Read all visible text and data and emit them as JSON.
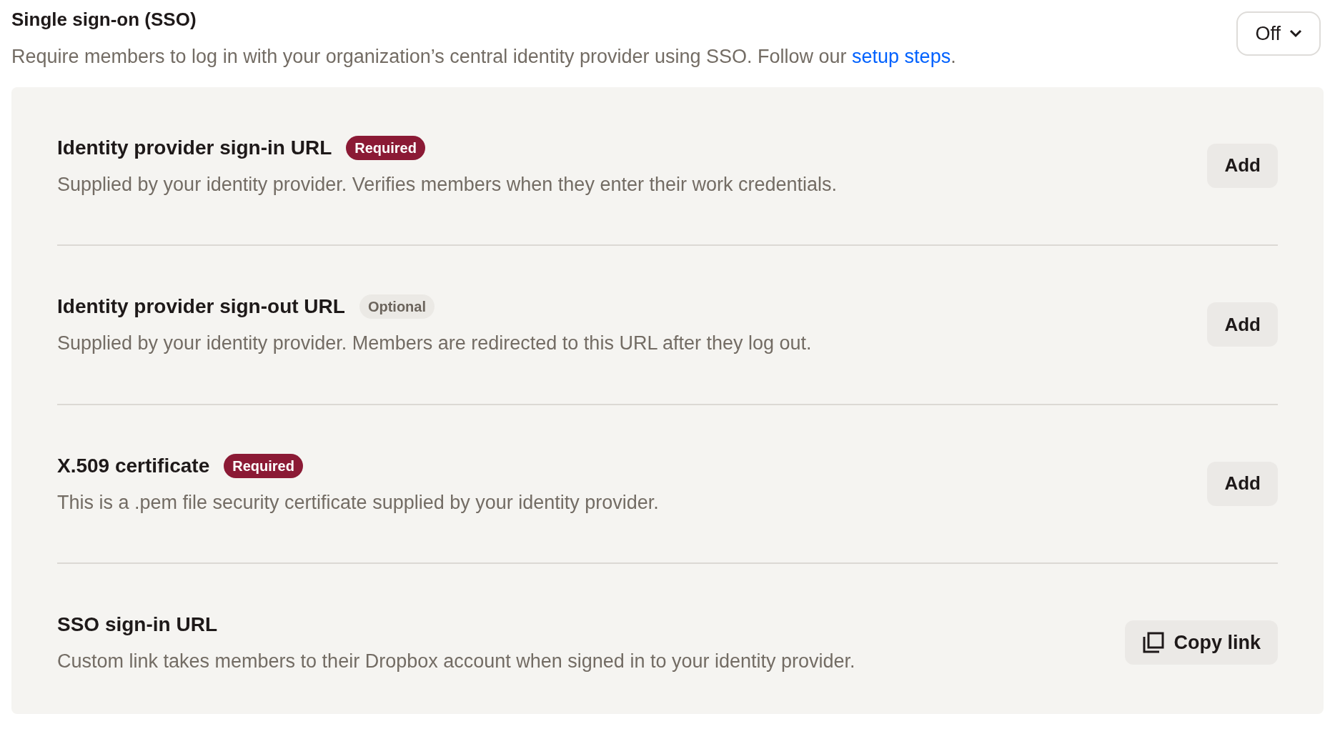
{
  "header": {
    "title": "Single sign-on (SSO)",
    "description": "Require members to log in with your organization’s central identity provider using SSO. Follow our ",
    "link": "setup steps",
    "description_end": "."
  },
  "dropdown": {
    "value": "Off"
  },
  "rows": [
    {
      "title": "Identity provider sign-in URL",
      "badge": {
        "kind": "required",
        "label": "Required"
      },
      "description": "Supplied by your identity provider. Verifies members when they enter their work credentials.",
      "button": {
        "kind": "add",
        "label": "Add"
      }
    },
    {
      "title": "Identity provider sign-out URL",
      "badge": {
        "kind": "optional",
        "label": "Optional"
      },
      "description": "Supplied by your identity provider. Members are redirected to this URL after they log out.",
      "button": {
        "kind": "add",
        "label": "Add"
      }
    },
    {
      "title": "X.509 certificate",
      "badge": {
        "kind": "required",
        "label": "Required"
      },
      "description": "This is a .pem file security certificate supplied by your identity provider.",
      "button": {
        "kind": "add",
        "label": "Add"
      }
    },
    {
      "title": "SSO sign-in URL",
      "description": "Custom link takes members to their Dropbox account when signed in to your identity provider.",
      "button": {
        "kind": "copy",
        "label": "Copy link"
      }
    }
  ]
}
